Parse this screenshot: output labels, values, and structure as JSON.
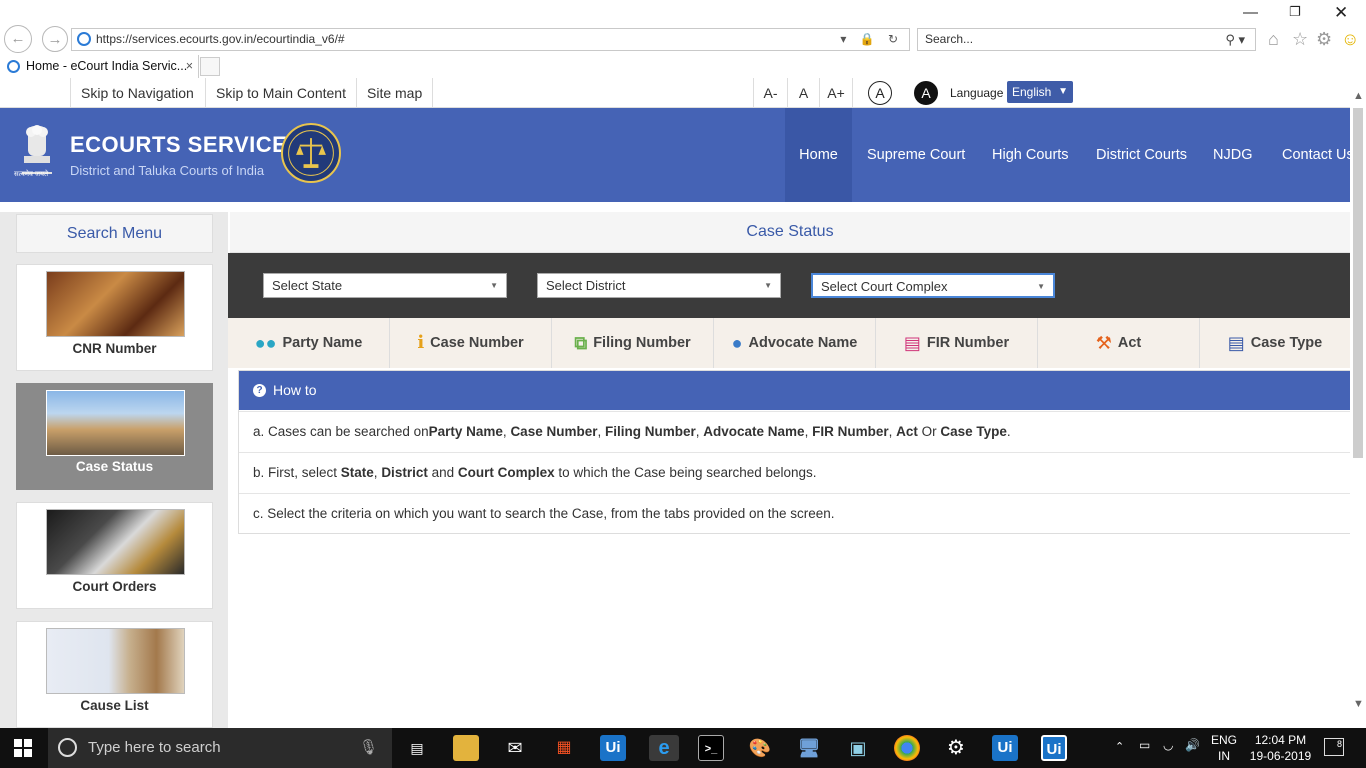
{
  "browser": {
    "url": "https://services.ecourts.gov.in/ecourtindia_v6/#",
    "search_placeholder": "Search...",
    "tab_title": "Home - eCourt India Servic...",
    "tab_close": "×"
  },
  "access_bar": {
    "skip_nav": "Skip to Navigation",
    "skip_main": "Skip to Main Content",
    "sitemap": "Site map",
    "font_minus": "A-",
    "font_normal": "A",
    "font_plus": "A+",
    "contrast_light": "A",
    "contrast_dark": "A",
    "language_label": "Language",
    "language_value": "English"
  },
  "header": {
    "brand": "ECOURTS SERVICES",
    "subtitle": "District and Taluka Courts of India",
    "emblem_caption": "सत्यमेव जयते",
    "nav": [
      "Home",
      "Supreme Court",
      "High Courts",
      "District Courts",
      "NJDG",
      "Contact Us"
    ]
  },
  "search_menu": {
    "title": "Search Menu",
    "items": [
      {
        "label": "CNR Number",
        "selected": false
      },
      {
        "label": "Case Status",
        "selected": true
      },
      {
        "label": "Court Orders",
        "selected": false
      },
      {
        "label": "Cause List",
        "selected": false
      }
    ]
  },
  "main": {
    "title": "Case Status",
    "selects": [
      {
        "value": "Select State"
      },
      {
        "value": "Select District"
      },
      {
        "value": "Select Court Complex"
      }
    ],
    "tabs": [
      {
        "label": "Party Name",
        "icon": "users-icon"
      },
      {
        "label": "Case Number",
        "icon": "info-icon"
      },
      {
        "label": "Filing Number",
        "icon": "copy-icon"
      },
      {
        "label": "Advocate Name",
        "icon": "user-icon"
      },
      {
        "label": "FIR Number",
        "icon": "list-alt-icon"
      },
      {
        "label": "Act",
        "icon": "gavel-icon"
      },
      {
        "label": "Case Type",
        "icon": "file-text-icon"
      }
    ],
    "howto": {
      "title": "How to",
      "row_a_prefix": "a. Cases can be searched on",
      "row_a_party": "Party Name",
      "row_a_case": "Case Number",
      "row_a_filing": "Filing Number",
      "row_a_adv": "Advocate Name",
      "row_a_fir": "FIR Number",
      "row_a_act": "Act",
      "row_a_or": " Or ",
      "row_a_type": "Case Type",
      "row_b_prefix": "b. First, select ",
      "row_b_state": "State",
      "row_b_district": "District",
      "row_b_and": " and ",
      "row_b_complex": "Court Complex",
      "row_b_suffix": " to which the Case being searched belongs.",
      "row_c": "c. Select the criteria on which you want to search the Case, from the tabs provided on the screen."
    }
  },
  "taskbar": {
    "search_placeholder": "Type here to search",
    "lang_line1": "ENG",
    "lang_line2": "IN",
    "time": "12:04 PM",
    "date": "19-06-2019",
    "notifications": "8"
  },
  "colors": {
    "header_blue": "#4563b5",
    "selbar_dark": "#3b3b3b",
    "tab_bg": "#f5f0ea",
    "party_icon": "#2aa6c4",
    "info_icon": "#e6a11a",
    "copy_icon": "#6ab04c",
    "user_icon": "#3a7bc8",
    "fir_icon": "#d0357a",
    "gavel_icon": "#e5621c",
    "file_icon": "#3a5aa8"
  }
}
